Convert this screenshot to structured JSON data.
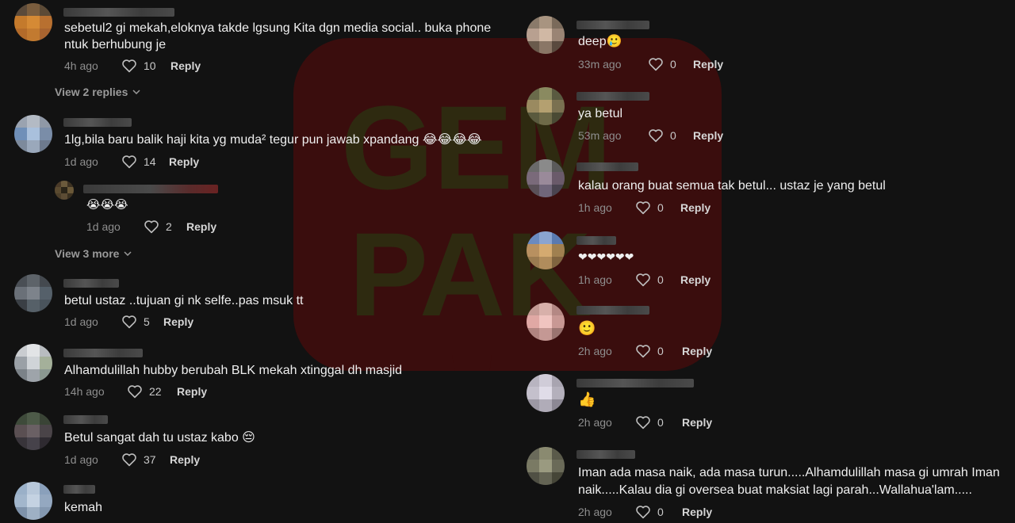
{
  "watermark": {
    "text_top": "GEM",
    "text_bottom": "PAK"
  },
  "reply_label": "Reply",
  "left": {
    "comments": [
      {
        "text": "sebetul2 gi mekah,eloknya takde lgsung Kita dgn media social.. buka phone",
        "text2": "ntuk berhubung je",
        "time": "4h ago",
        "likes": "10"
      },
      {
        "text": "1lg,bila baru balik haji kita yg muda² tegur pun jawab xpandang 😂😂😂😂",
        "time": "1d ago",
        "likes": "14"
      },
      {
        "text": "😭😭😭",
        "time": "1d ago",
        "likes": "2"
      },
      {
        "text": "betul ustaz ..tujuan gi nk selfe..pas msuk tt",
        "time": "1d ago",
        "likes": "5"
      },
      {
        "text": "Alhamdulillah hubby berubah BLK mekah xtinggal dh masjid",
        "time": "14h ago",
        "likes": "22"
      },
      {
        "text": "Betul sangat dah tu ustaz kabo 😔",
        "time": "1d ago",
        "likes": "37"
      },
      {
        "text": "kemah"
      }
    ],
    "view_replies": "View 2 replies",
    "view_more": "View 3 more"
  },
  "right": {
    "comments": [
      {
        "text": "deep🥲",
        "time": "33m ago",
        "likes": "0"
      },
      {
        "text": "ya betul",
        "time": "53m ago",
        "likes": "0"
      },
      {
        "text": "kalau orang buat semua tak betul... ustaz je yang betul",
        "time": "1h ago",
        "likes": "0"
      },
      {
        "text": "❤❤❤❤❤❤",
        "time": "1h ago",
        "likes": "0"
      },
      {
        "text": "🙂",
        "time": "2h ago",
        "likes": "0"
      },
      {
        "text": "👍",
        "time": "2h ago",
        "likes": "0"
      },
      {
        "text": "Iman ada masa naik, ada masa turun.....Alhamdulillah masa gi umrah Iman",
        "text2": "naik.....Kalau dia gi oversea buat maksiat lagi parah...Wallahua'lam.....",
        "time": "2h ago",
        "likes": "0"
      }
    ]
  },
  "colors": {
    "background": "#121212",
    "watermark": "#5a1212",
    "meta": "#8e8e8e"
  }
}
